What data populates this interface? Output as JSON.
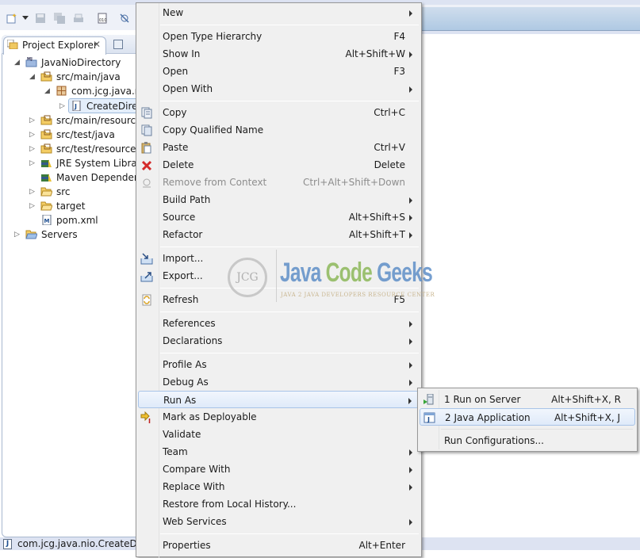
{
  "window": {
    "accent_color": "#afc9e3"
  },
  "project_explorer": {
    "tab_label": "Project Explorer",
    "close_icon": "close-icon",
    "tree": [
      {
        "label": "JavaNioDirectory",
        "icon": "maven-project-icon",
        "expanded": true
      },
      {
        "label": "src/main/java",
        "icon": "source-folder-icon",
        "expanded": true
      },
      {
        "label": "com.jcg.java.nio",
        "icon": "package-icon",
        "expanded": true
      },
      {
        "label": "CreateDirectory.java",
        "display": "CreateDirec",
        "icon": "java-file-icon",
        "selected": true
      },
      {
        "label": "src/main/resources",
        "display": "src/main/resource",
        "icon": "source-folder-icon"
      },
      {
        "label": "src/test/java",
        "icon": "source-folder-icon"
      },
      {
        "label": "src/test/resources",
        "icon": "source-folder-icon"
      },
      {
        "label": "JRE System Library",
        "icon": "library-icon"
      },
      {
        "label": "Maven Dependencies",
        "display": "Maven Dependenc",
        "icon": "library-icon"
      },
      {
        "label": "src",
        "icon": "folder-icon"
      },
      {
        "label": "target",
        "icon": "folder-icon"
      },
      {
        "label": "pom.xml",
        "icon": "maven-file-icon"
      },
      {
        "label": "Servers",
        "icon": "folder-icon"
      }
    ]
  },
  "status_bar": {
    "text": "com.jcg.java.nio.CreateDirec"
  },
  "context_menu": {
    "items": [
      {
        "label": "New",
        "shortcut": "",
        "submenu": true
      },
      {
        "label": "Open Type Hierarchy",
        "shortcut": "F4"
      },
      {
        "label": "Show In",
        "shortcut": "Alt+Shift+W",
        "submenu": true
      },
      {
        "label": "Open",
        "shortcut": "F3"
      },
      {
        "label": "Open With",
        "shortcut": "",
        "submenu": true
      },
      {
        "label": "Copy",
        "shortcut": "Ctrl+C",
        "icon": "copy-icon"
      },
      {
        "label": "Copy Qualified Name",
        "shortcut": "",
        "icon": "copy-qualified-icon"
      },
      {
        "label": "Paste",
        "shortcut": "Ctrl+V",
        "icon": "paste-icon"
      },
      {
        "label": "Delete",
        "shortcut": "Delete",
        "icon": "delete-icon"
      },
      {
        "label": "Remove from Context",
        "shortcut": "Ctrl+Alt+Shift+Down",
        "icon": "remove-context-icon",
        "disabled": true
      },
      {
        "label": "Build Path",
        "shortcut": "",
        "submenu": true
      },
      {
        "label": "Source",
        "shortcut": "Alt+Shift+S",
        "submenu": true
      },
      {
        "label": "Refactor",
        "shortcut": "Alt+Shift+T",
        "submenu": true
      },
      {
        "label": "Import...",
        "shortcut": "",
        "icon": "import-icon"
      },
      {
        "label": "Export...",
        "shortcut": "",
        "icon": "export-icon"
      },
      {
        "label": "Refresh",
        "shortcut": "F5",
        "icon": "refresh-icon"
      },
      {
        "label": "References",
        "shortcut": "",
        "submenu": true
      },
      {
        "label": "Declarations",
        "shortcut": "",
        "submenu": true
      },
      {
        "label": "Profile As",
        "shortcut": "",
        "submenu": true
      },
      {
        "label": "Debug As",
        "shortcut": "",
        "submenu": true
      },
      {
        "label": "Run As",
        "shortcut": "",
        "submenu": true,
        "highlighted": true
      },
      {
        "label": "Mark as Deployable",
        "shortcut": "",
        "icon": "deploy-icon"
      },
      {
        "label": "Validate",
        "shortcut": ""
      },
      {
        "label": "Team",
        "shortcut": "",
        "submenu": true
      },
      {
        "label": "Compare With",
        "shortcut": "",
        "submenu": true
      },
      {
        "label": "Replace With",
        "shortcut": "",
        "submenu": true
      },
      {
        "label": "Restore from Local History...",
        "shortcut": ""
      },
      {
        "label": "Web Services",
        "shortcut": "",
        "submenu": true
      },
      {
        "label": "Properties",
        "shortcut": "Alt+Enter"
      }
    ]
  },
  "run_as_submenu": {
    "items": [
      {
        "label": "1 Run on Server",
        "shortcut": "Alt+Shift+X, R",
        "icon": "run-on-server-icon"
      },
      {
        "label": "2 Java Application",
        "shortcut": "Alt+Shift+X, J",
        "icon": "java-application-icon",
        "highlighted": true
      },
      {
        "label": "Run Configurations...",
        "shortcut": ""
      }
    ]
  },
  "watermark": {
    "logo_text": "JCG",
    "title_java": "Java",
    "title_code": "Code",
    "title_geeks": "Geeks",
    "subtitle": "JAVA 2 JAVA DEVELOPERS RESOURCE CENTER"
  }
}
